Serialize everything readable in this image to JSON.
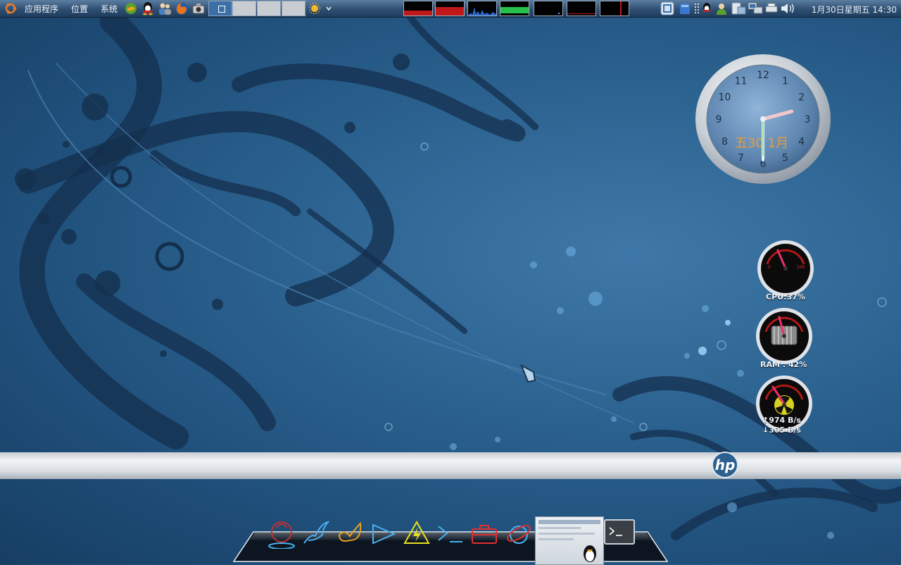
{
  "top_panel": {
    "menu": {
      "applications": "应用程序",
      "places": "位置",
      "system": "系统"
    },
    "launchers": [
      "fish-icon",
      "qq-icon",
      "contacts-icon",
      "firefox-icon",
      "camera-icon"
    ],
    "workspaces": [
      "1",
      "2",
      "3",
      "4"
    ],
    "active_workspace": 1,
    "monitors": [
      "cpu-monitor",
      "memory-monitor",
      "network-monitor",
      "swap-monitor",
      "load-monitor",
      "disk-monitor",
      "temp-monitor"
    ],
    "tray_icons": [
      "window-switcher-icon",
      "files-icon",
      "qq-tray-icon",
      "user-icon",
      "clipboard-icon",
      "network-icon",
      "printer-icon",
      "volume-icon"
    ],
    "datetime": "1月30日星期五 14:30"
  },
  "clock_widget": {
    "date_text": "五30 1月",
    "numerals": [
      "12",
      "1",
      "2",
      "3",
      "4",
      "5",
      "6",
      "7",
      "8",
      "9",
      "10",
      "11"
    ],
    "time": {
      "hour": 2,
      "minute": 30
    }
  },
  "gauges": {
    "cpu": {
      "label": "CPU:37%",
      "value": 0.37
    },
    "ram": {
      "label": "RAM : 42%",
      "value": 0.42
    },
    "net": {
      "up": "↑974 B/s",
      "down": "↓305 B/s"
    }
  },
  "brand": {
    "logo_text": "hp"
  },
  "dock": {
    "items": [
      "power-icon",
      "bird-icon",
      "butterfly-icon",
      "play-icon",
      "warning-icon",
      "terminal-prompt-icon",
      "toolbox-icon",
      "browser-icon",
      "window-thumbnail",
      "terminal-window-icon"
    ]
  },
  "colors": {
    "panel_top": "#5b7da0",
    "panel_bottom": "#1f3d5e",
    "desktop": "#2d6492",
    "clock_date": "#e89a3c",
    "gauge_needle": "#e8316b"
  }
}
